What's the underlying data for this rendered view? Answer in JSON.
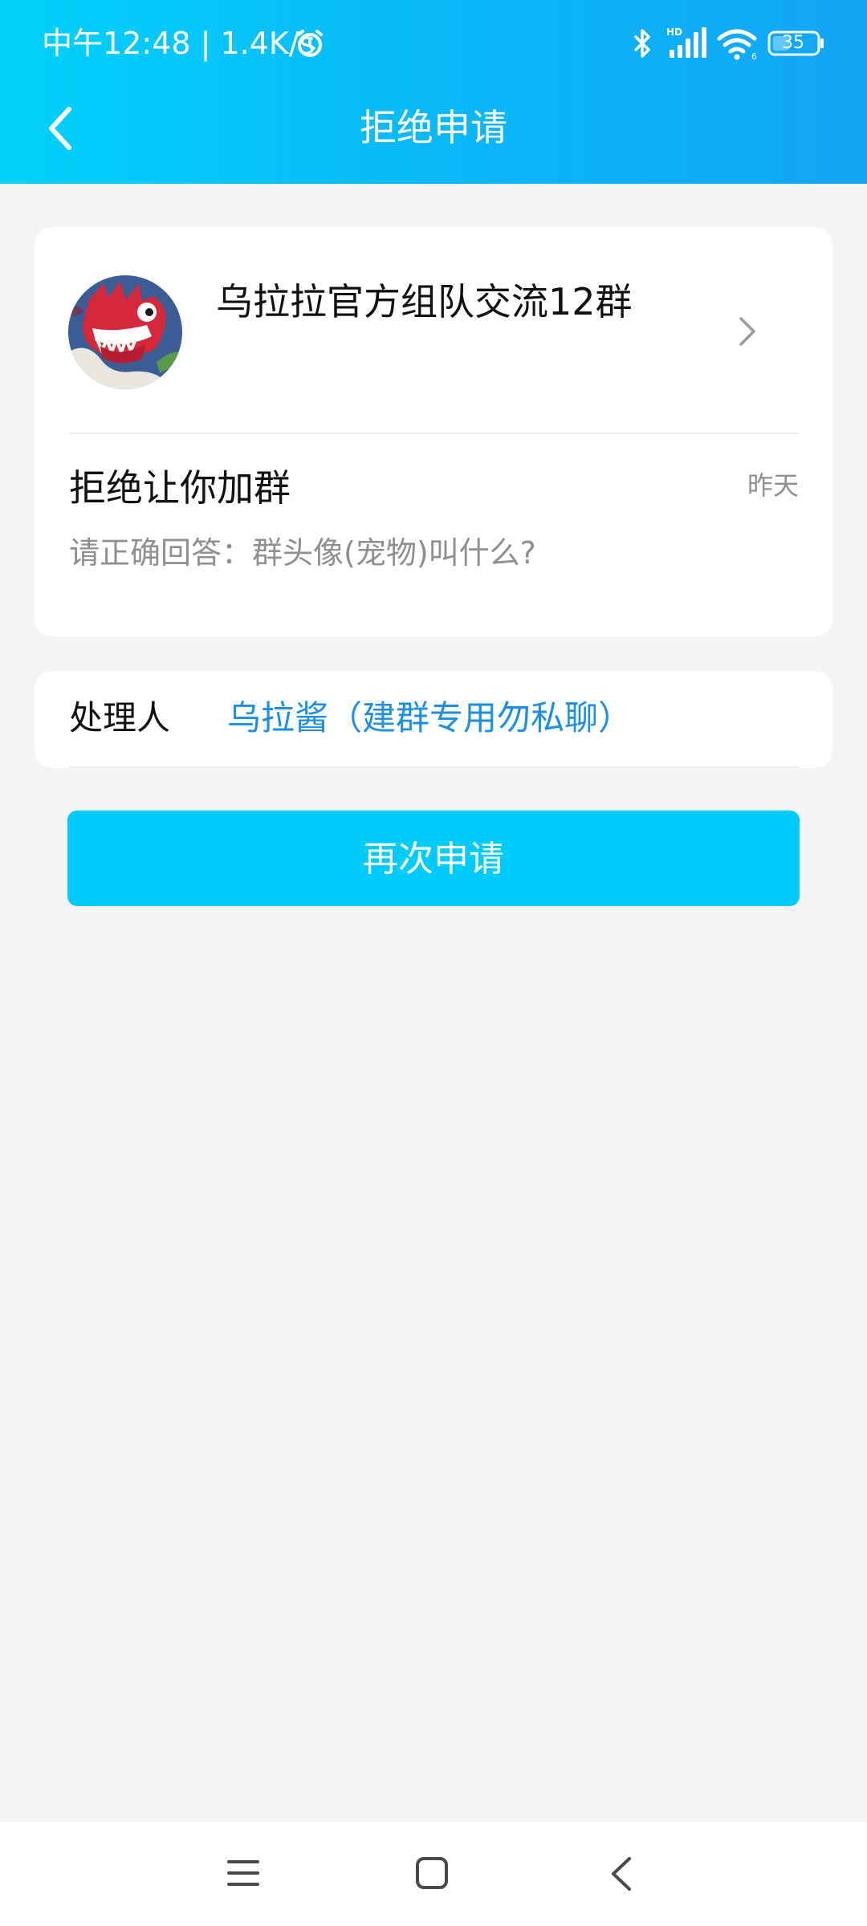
{
  "status_bar": {
    "time_text": "中午12:48 | 1.4K/s",
    "battery_level": "35",
    "icons": [
      "alarm-icon",
      "bluetooth-icon",
      "signal-icon",
      "wifi-icon",
      "battery-icon"
    ]
  },
  "header": {
    "title": "拒绝申请",
    "back_icon": "back-icon"
  },
  "request_card": {
    "group_name": "乌拉拉官方组队交流12群",
    "status_title": "拒绝让你加群",
    "time": "昨天",
    "message": "请正确回答：群头像(宠物)叫什么?"
  },
  "handler": {
    "label": "处理人",
    "name": "乌拉酱（建群专用勿私聊）"
  },
  "actions": {
    "reapply_label": "再次申请"
  },
  "nav": {
    "icons": [
      "menu-icon",
      "home-icon",
      "back-icon"
    ]
  },
  "colors": {
    "header_gradient_start": "#00d2fb",
    "header_gradient_end": "#12a5f5",
    "accent": "#00ccfb",
    "link": "#1b8ee6",
    "background": "#f4f4f5"
  }
}
